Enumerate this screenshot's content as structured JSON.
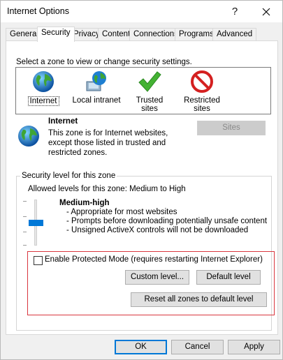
{
  "window": {
    "title": "Internet Options",
    "help_glyph": "?"
  },
  "tabs": [
    {
      "label": "General"
    },
    {
      "label": "Security"
    },
    {
      "label": "Privacy"
    },
    {
      "label": "Content"
    },
    {
      "label": "Connections"
    },
    {
      "label": "Programs"
    },
    {
      "label": "Advanced"
    }
  ],
  "active_tab": "Security",
  "zone_prompt": "Select a zone to view or change security settings.",
  "zones": [
    {
      "label": "Internet",
      "icon": "globe-icon",
      "selected": true
    },
    {
      "label": "Local intranet",
      "icon": "intranet-icon"
    },
    {
      "label": "Trusted sites",
      "icon": "checkmark-icon"
    },
    {
      "label": "Restricted sites",
      "icon": "restricted-icon"
    }
  ],
  "zone_info": {
    "title": "Internet",
    "description": "This zone is for Internet websites, except those listed in trusted and restricted zones.",
    "icon": "globe-icon"
  },
  "sites_button": "Sites",
  "security_level": {
    "legend": "Security level for this zone",
    "allowed": "Allowed levels for this zone: Medium to High",
    "level_name": "Medium-high",
    "details": [
      "- Appropriate for most websites",
      "- Prompts before downloading potentially unsafe content",
      "- Unsigned ActiveX controls will not be downloaded"
    ]
  },
  "protected_mode": {
    "label": "Enable Protected Mode (requires restarting Internet Explorer)",
    "checked": false
  },
  "buttons": {
    "custom_level": "Custom level...",
    "default_level": "Default level",
    "reset_all": "Reset all zones to default level",
    "ok": "OK",
    "cancel": "Cancel",
    "apply": "Apply"
  },
  "colors": {
    "accent": "#0078d7",
    "highlight_border": "#d9363e"
  }
}
